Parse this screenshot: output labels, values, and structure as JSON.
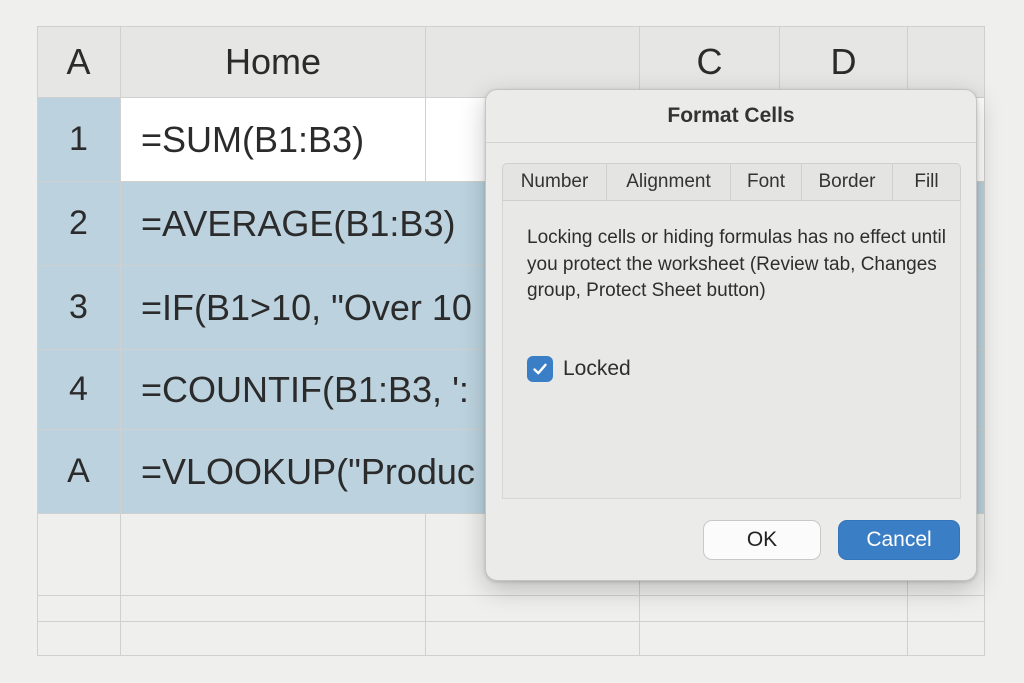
{
  "spreadsheet": {
    "column_headers": [
      "A",
      "Home",
      "",
      "C",
      "D",
      ""
    ],
    "rows": [
      {
        "header": "1",
        "formula": "=SUM(B1:B3)"
      },
      {
        "header": "2",
        "formula": "=AVERAGE(B1:B3)"
      },
      {
        "header": "3",
        "formula": "=IF(B1>10, \"Over 10"
      },
      {
        "header": "4",
        "formula": "=COUNTIF(B1:B3, ':"
      },
      {
        "header": "A",
        "formula": "=VLOOKUP(\"Produc"
      }
    ]
  },
  "dialog": {
    "title": "Format Cells",
    "tabs": [
      "Number",
      "Alignment",
      "Font",
      "Border",
      "Fill"
    ],
    "message": "Locking cells or hiding formulas has no effect until you protect the worksheet (Review tab, Changes group, Protect Sheet button)",
    "checkbox": {
      "label": "Locked",
      "checked": true
    },
    "ok_label": "OK",
    "cancel_label": "Cancel"
  },
  "colors": {
    "selection": "#bcd3df",
    "accent": "#3a7ec6"
  }
}
